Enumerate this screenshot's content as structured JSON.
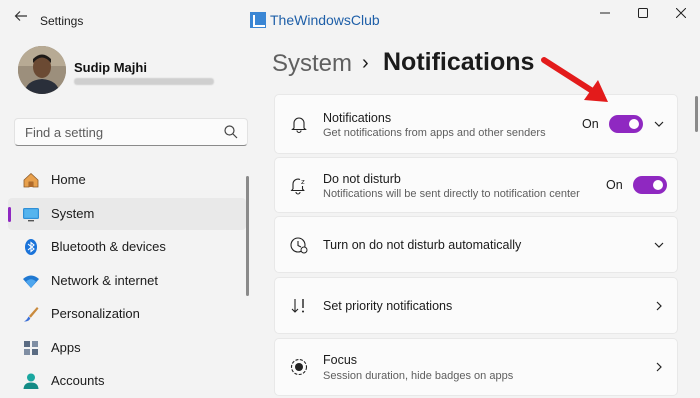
{
  "window": {
    "title": "Settings",
    "watermark": "TheWindowsClub",
    "controls": [
      "minimize-icon",
      "maximize-icon",
      "close-icon"
    ]
  },
  "profile": {
    "name": "Sudip Majhi"
  },
  "search": {
    "placeholder": "Find a setting"
  },
  "sidebar": {
    "items": [
      {
        "label": "Home",
        "icon": "home-icon",
        "selected": false
      },
      {
        "label": "System",
        "icon": "monitor-icon",
        "selected": true
      },
      {
        "label": "Bluetooth & devices",
        "icon": "bluetooth-icon",
        "selected": false
      },
      {
        "label": "Network & internet",
        "icon": "wifi-icon",
        "selected": false
      },
      {
        "label": "Personalization",
        "icon": "brush-icon",
        "selected": false
      },
      {
        "label": "Apps",
        "icon": "apps-icon",
        "selected": false
      },
      {
        "label": "Accounts",
        "icon": "person-icon",
        "selected": false
      }
    ]
  },
  "header": {
    "parent": "System",
    "separator": "›",
    "page": "Notifications"
  },
  "cards": [
    {
      "title": "Notifications",
      "description": "Get notifications from apps and other senders",
      "state": "On",
      "toggle": true,
      "control": "chevron-down"
    },
    {
      "title": "Do not disturb",
      "description": "Notifications will be sent directly to notification center",
      "state": "On",
      "toggle": true
    },
    {
      "title": "Turn on do not disturb automatically",
      "control": "chevron-down"
    },
    {
      "title": "Set priority notifications",
      "control": "chevron-right"
    },
    {
      "title": "Focus",
      "description": "Session duration, hide badges on apps",
      "control": "chevron-right"
    }
  ],
  "colors": {
    "accent": "#8f28c1",
    "annotation_arrow": "#e31b1b"
  }
}
